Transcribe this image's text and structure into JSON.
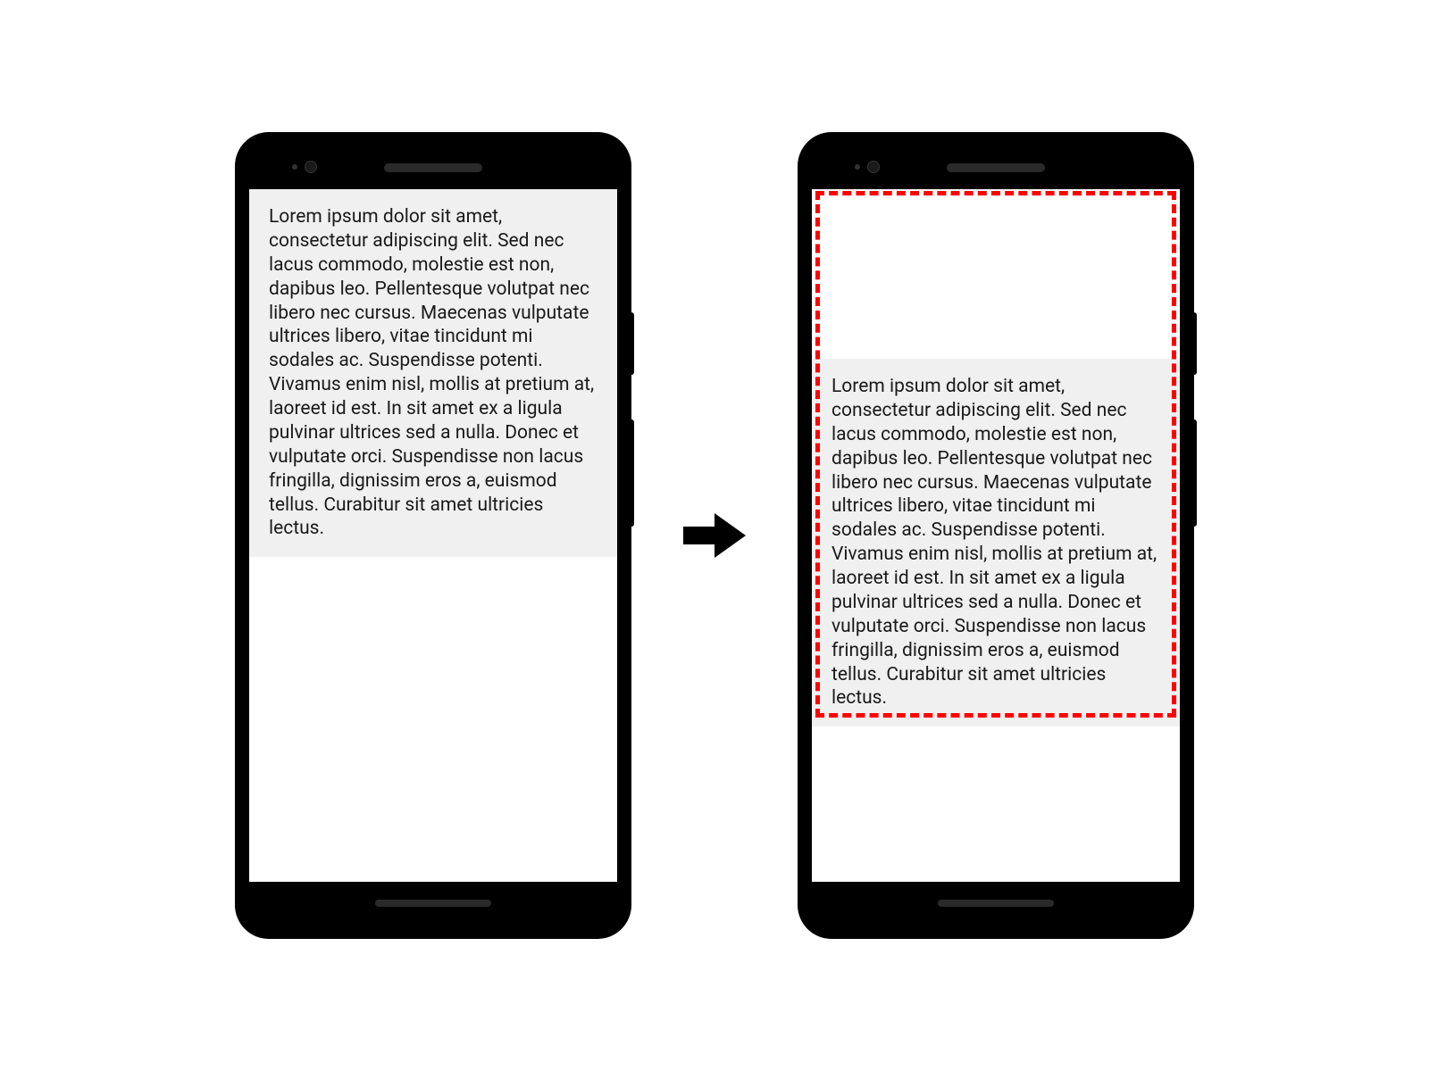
{
  "diagram": {
    "lorem_text": "Lorem ipsum dolor sit amet, consectetur adipiscing elit. Sed nec lacus commodo, molestie est non, dapibus leo. Pellentesque volutpat nec libero nec cursus. Maecenas vulputate ultrices libero, vitae tincidunt mi sodales ac. Suspendisse potenti. Vivamus enim nisl, mollis at pretium at, laoreet id est. In sit amet ex a ligula pulvinar ultrices sed a nulla. Donec et vulputate orci. Suspendisse non lacus fringilla, dignissim eros a, euismod tellus. Curabitur sit amet ultricies lectus.",
    "highlight_color": "#ff0000",
    "text_background": "#f0f0f0"
  }
}
